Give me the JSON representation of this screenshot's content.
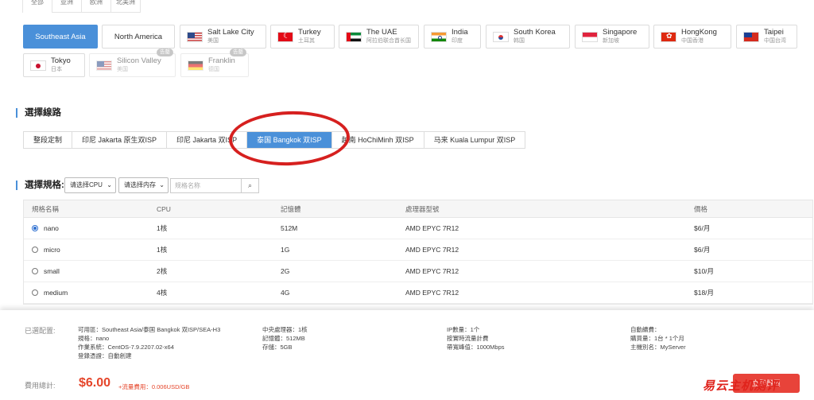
{
  "region_tabs": [
    "全部",
    "亚洲",
    "欧洲",
    "北美洲"
  ],
  "locations": [
    {
      "name": "Southeast Asia",
      "sub": "",
      "flag": "",
      "state": "active"
    },
    {
      "name": "North America",
      "sub": "",
      "flag": "",
      "state": "plain"
    },
    {
      "name": "Salt Lake City",
      "sub": "美国",
      "flag": "us-flag-icon"
    },
    {
      "name": "Turkey",
      "sub": "土耳其",
      "flag": "tr-flag-icon"
    },
    {
      "name": "The UAE",
      "sub": "阿拉伯联合酋长国",
      "flag": "ae-flag-icon"
    },
    {
      "name": "India",
      "sub": "印度",
      "flag": "in-flag-icon"
    },
    {
      "name": "South Korea",
      "sub": "韩国",
      "flag": "kr-flag-icon"
    },
    {
      "name": "Singapore",
      "sub": "新加坡",
      "flag": "sg-flag-icon"
    },
    {
      "name": "HongKong",
      "sub": "中国香港",
      "flag": "hk-flag-icon"
    },
    {
      "name": "Taipei",
      "sub": "中国台湾",
      "flag": "tw-flag-icon"
    },
    {
      "name": "Tokyo",
      "sub": "日本",
      "flag": "jp-flag-icon"
    },
    {
      "name": "Silicon Valley",
      "sub": "美国",
      "flag": "us-flag-icon",
      "tag": "告罄",
      "state": "disabled"
    },
    {
      "name": "Franklin",
      "sub": "德国",
      "flag": "de-flag-icon",
      "tag": "告罄",
      "state": "disabled"
    }
  ],
  "route_section": {
    "title": "選擇線路",
    "routes": [
      "整段定制",
      "印尼 Jakarta 原生双ISP",
      "印尼 Jakarta 双ISP",
      "泰国 Bangkok 双ISP",
      "越南 HoChiMinh 双ISP",
      "马来 Kuala Lumpur 双ISP"
    ],
    "active_index": 3
  },
  "spec_section": {
    "title": "選擇規格:",
    "cpu_select": "请选择CPU",
    "mem_select": "请选择内存",
    "search_placeholder": "规格名称"
  },
  "table": {
    "headers": [
      "規格名稱",
      "CPU",
      "記憶體",
      "處理器型號",
      "價格"
    ],
    "rows": [
      {
        "name": "nano",
        "cpu": "1核",
        "mem": "512M",
        "model": "AMD EPYC 7R12",
        "price": "$6/月",
        "selected": true
      },
      {
        "name": "micro",
        "cpu": "1核",
        "mem": "1G",
        "model": "AMD EPYC 7R12",
        "price": "$6/月",
        "selected": false
      },
      {
        "name": "small",
        "cpu": "2核",
        "mem": "2G",
        "model": "AMD EPYC 7R12",
        "price": "$10/月",
        "selected": false
      },
      {
        "name": "medium",
        "cpu": "4核",
        "mem": "4G",
        "model": "AMD EPYC 7R12",
        "price": "$18/月",
        "selected": false
      }
    ]
  },
  "summary": {
    "config_label": "已選配置:",
    "col1": [
      "可用區：Southeast Asia/泰国 Bangkok 双ISP/SEA-H3",
      "規格：nano",
      "作業系統：CentOS-7.9.2207.02-x64",
      "登錄憑證：自動創建"
    ],
    "col2": [
      "中央處理器：1核",
      "記憶體：512MB",
      "存儲：5GB"
    ],
    "col3": [
      "IP數量：1个",
      "按實時流量計費",
      "帶寬峰值：1000Mbps"
    ],
    "col4": [
      "自動續費：",
      "購買量：1台 * 1个月",
      "主機別名：MyServer"
    ],
    "total_label": "費用總計:",
    "price": "$6.00",
    "traffic_fee": "+流量費用：0.006USD/GB",
    "buy_label": "立即購買"
  },
  "watermark": "易云主机测评"
}
